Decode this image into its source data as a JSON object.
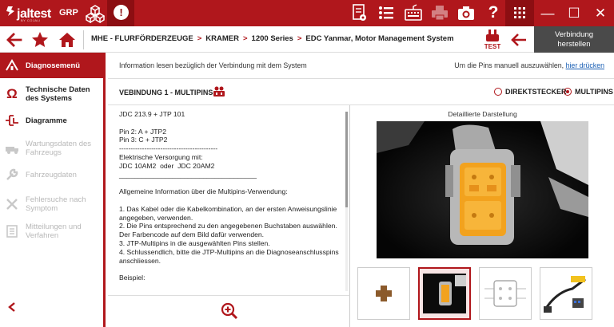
{
  "topbar": {
    "logo_text": "jaltest",
    "logo_sub": "BY COJALI",
    "grp_label": "GRP",
    "alert_symbol": "!",
    "icons": [
      "document-icon",
      "list-icon",
      "keyboard-icon",
      "printer-icon",
      "camera-icon",
      "help-icon",
      "grid-icon"
    ],
    "window_buttons": {
      "minimize": "—",
      "maximize": "☐",
      "close": "✕"
    }
  },
  "breadcrumb": {
    "items": [
      "MHE - FLURFÖRDERZEUGE",
      "KRAMER",
      "1200 Series",
      "EDC Yanmar, Motor Management System"
    ],
    "separator": ">",
    "test_label": "TEST"
  },
  "connect_button": {
    "line1": "Verbindung",
    "line2": "herstellen"
  },
  "sidebar": {
    "items": [
      {
        "label": "Diagnosemenü",
        "icon": "diagnosis-icon",
        "active": true,
        "enabled": true
      },
      {
        "label": "Technische Daten des Systems",
        "icon": "omega-icon",
        "active": false,
        "enabled": true
      },
      {
        "label": "Diagramme",
        "icon": "diagram-icon",
        "active": false,
        "enabled": true
      },
      {
        "label": "Wartungsdaten des Fahrzeugs",
        "icon": "truck-icon",
        "active": false,
        "enabled": false
      },
      {
        "label": "Fahrzeugdaten",
        "icon": "wrench-icon",
        "active": false,
        "enabled": false
      },
      {
        "label": "Fehlersuche nach Symptom",
        "icon": "tools-icon",
        "active": false,
        "enabled": false
      },
      {
        "label": "Mitteilungen und Verfahren",
        "icon": "document-list-icon",
        "active": false,
        "enabled": false
      }
    ]
  },
  "info": {
    "left_text": "Information lesen bezüglich der Verbindung mit dem System",
    "right_text": "Um die Pins manuell auszuwählen, ",
    "right_link": "hier drücken"
  },
  "connection": {
    "title": "VEBINDUNG 1 - MULTIPINS",
    "options": [
      {
        "label": "DIREKTSTECKER",
        "selected": false
      },
      {
        "label": "MULTIPINS",
        "selected": true
      }
    ]
  },
  "instructions": {
    "text": "JDC 213.9 + JTP 101\n\nPin 2: A + JTP2\nPin 3: C + JTP2\n-------------------------------------------\nElektrische Versorgung mit:\nJDC 10AM2  oder  JDC 20AM2\n____________________________________\n\nAllgemeine Information über die Multipins-Verwendung:\n\n1. Das Kabel oder die Kabelkombination, an der ersten Anweisungslinie angegeben, verwenden.\n2. Die Pins entsprechend zu den angegebenen Buchstaben auswählen. Der Farbencode auf dem Bild dafür verwenden.\n3. JTP-Multipins in die ausgewählten Pins stellen.\n4. Schlussendlich, bitte die JTP-Multipins an die Diagnoseanschlusspins anschliessen.\n\nBeispiel:"
  },
  "image_panel": {
    "caption": "Detaillierte Darstellung",
    "thumbnails": [
      "add-thumbnail",
      "connector-photo-thumbnail",
      "pinout-diagram-thumbnail",
      "cable-thumbnail"
    ],
    "selected_thumbnail": 1
  },
  "colors": {
    "brand_red": "#b0171c",
    "dark_red": "#8c0e12",
    "link_blue": "#1a5fb4",
    "dark_gray": "#4a4a4a"
  }
}
